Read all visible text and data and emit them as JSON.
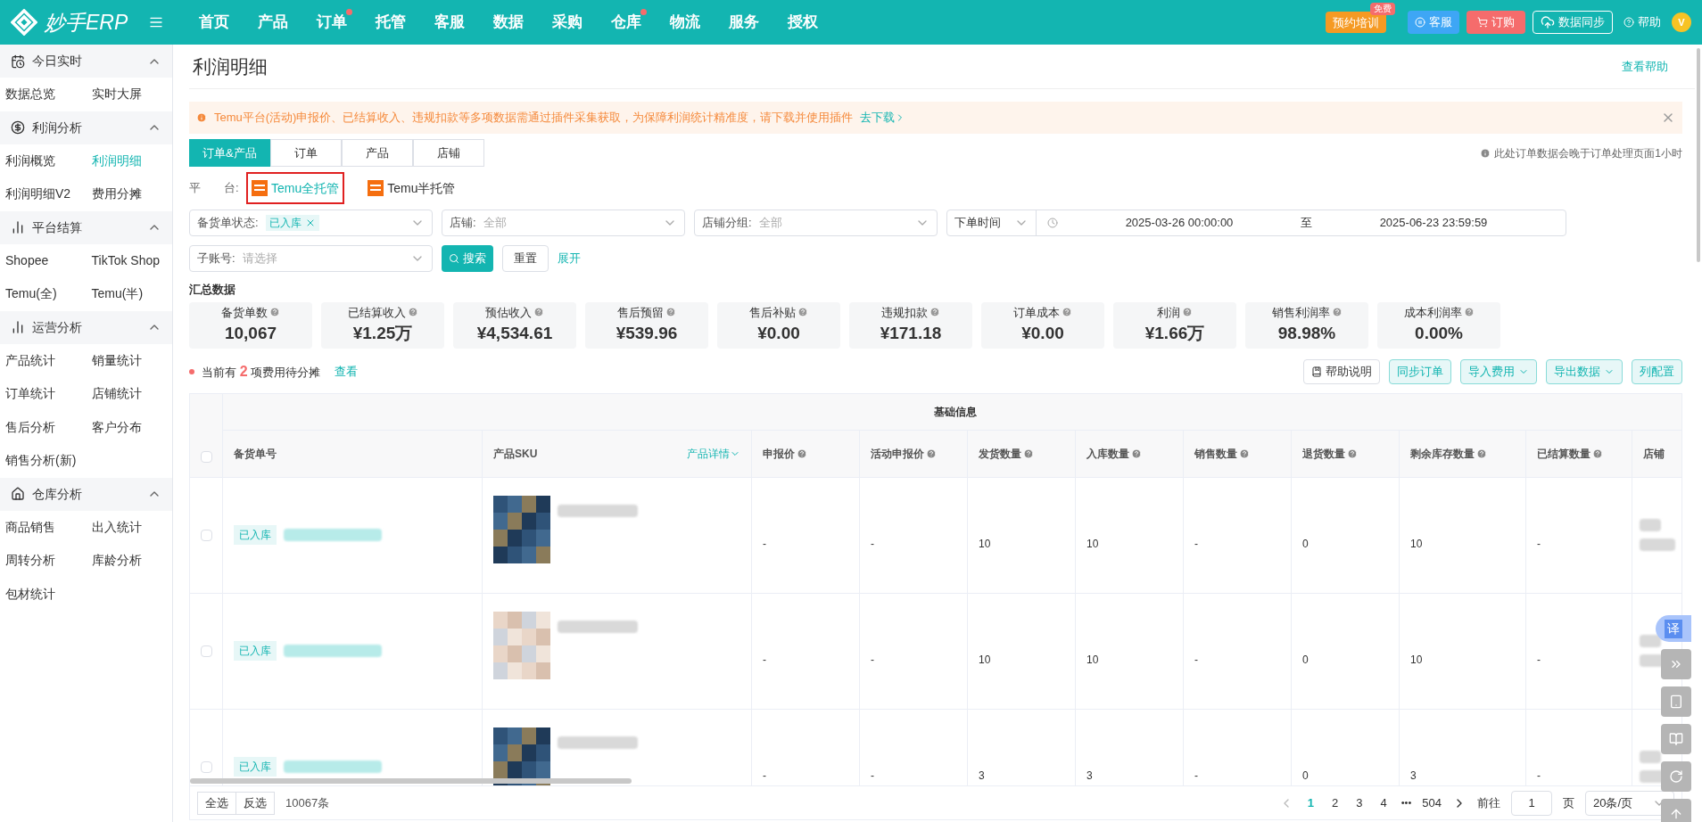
{
  "header": {
    "logo": "妙手ERP",
    "nav": [
      {
        "label": "首页",
        "dot": false
      },
      {
        "label": "产品",
        "dot": false
      },
      {
        "label": "订单",
        "dot": true
      },
      {
        "label": "托管",
        "dot": false
      },
      {
        "label": "客服",
        "dot": false
      },
      {
        "label": "数据",
        "dot": false
      },
      {
        "label": "采购",
        "dot": false
      },
      {
        "label": "仓库",
        "dot": true
      },
      {
        "label": "物流",
        "dot": false
      },
      {
        "label": "服务",
        "dot": false
      },
      {
        "label": "授权",
        "dot": false
      }
    ],
    "training": {
      "label": "预约培训",
      "badge": "免费"
    },
    "service": "客服",
    "order": "订购",
    "sync": "数据同步",
    "help": "帮助",
    "avatar": "V"
  },
  "sidebar": [
    {
      "title": "今日实时",
      "kind": "calendar",
      "expanded": true,
      "items": [
        {
          "label": "数据总览",
          "selected": false
        },
        {
          "label": "实时大屏",
          "selected": false
        }
      ]
    },
    {
      "title": "利润分析",
      "kind": "money",
      "expanded": true,
      "items": [
        {
          "label": "利润概览",
          "selected": false
        },
        {
          "label": "利润明细",
          "selected": true
        },
        {
          "label": "利润明细V2",
          "selected": false
        },
        {
          "label": "费用分摊",
          "selected": false
        }
      ]
    },
    {
      "title": "平台结算",
      "kind": "chart",
      "expanded": true,
      "items": [
        {
          "label": "Shopee",
          "selected": false
        },
        {
          "label": "TikTok Shop",
          "selected": false
        },
        {
          "label": "Temu(全)",
          "selected": false
        },
        {
          "label": "Temu(半)",
          "selected": false
        }
      ]
    },
    {
      "title": "运营分析",
      "kind": "chart",
      "expanded": true,
      "items": [
        {
          "label": "产品统计",
          "selected": false
        },
        {
          "label": "销量统计",
          "selected": false
        },
        {
          "label": "订单统计",
          "selected": false
        },
        {
          "label": "店铺统计",
          "selected": false
        },
        {
          "label": "售后分析",
          "selected": false
        },
        {
          "label": "客户分布",
          "selected": false
        },
        {
          "label": "销售分析(新)",
          "selected": false
        }
      ]
    },
    {
      "title": "仓库分析",
      "kind": "warehouse",
      "expanded": true,
      "items": [
        {
          "label": "商品销售",
          "selected": false
        },
        {
          "label": "出入统计",
          "selected": false
        },
        {
          "label": "周转分析",
          "selected": false
        },
        {
          "label": "库龄分析",
          "selected": false
        },
        {
          "label": "包材统计",
          "selected": false
        }
      ]
    }
  ],
  "page": {
    "title": "利润明细",
    "help_link": "查看帮助"
  },
  "alert": {
    "text": "Temu平台(活动)申报价、已结算收入、违规扣款等多项数据需通过插件采集获取，为保障利润统计精准度，请下载并使用插件",
    "link": "去下载"
  },
  "tabs": [
    {
      "label": "订单&产品",
      "selected": true
    },
    {
      "label": "订单",
      "selected": false
    },
    {
      "label": "产品",
      "selected": false
    },
    {
      "label": "店铺",
      "selected": false
    }
  ],
  "notice": "此处订单数据会晚于订单处理页面1小时",
  "platform": {
    "label": "平　　台:",
    "options": [
      {
        "label": "Temu全托管",
        "selected": true
      },
      {
        "label": "Temu半托管",
        "selected": false
      }
    ]
  },
  "filters": {
    "status": {
      "label": "备货单状态:",
      "tag": "已入库"
    },
    "shop": {
      "label": "店铺:",
      "placeholder": "全部"
    },
    "shop_group": {
      "label": "店铺分组:",
      "placeholder": "全部"
    },
    "time_type": "下单时间",
    "start": "2025-03-26 00:00:00",
    "sep": "至",
    "end": "2025-06-23 23:59:59",
    "sub_account": {
      "label": "子账号:",
      "placeholder": "请选择"
    },
    "search": "搜索",
    "reset": "重置",
    "expand": "展开"
  },
  "summary": {
    "title": "汇总数据",
    "cards": [
      {
        "label": "备货单数",
        "value": "10,067"
      },
      {
        "label": "已结算收入",
        "value": "¥1.25万"
      },
      {
        "label": "预估收入",
        "value": "¥4,534.61"
      },
      {
        "label": "售后预留",
        "value": "¥539.96"
      },
      {
        "label": "售后补贴",
        "value": "¥0.00"
      },
      {
        "label": "违规扣款",
        "value": "¥171.18"
      },
      {
        "label": "订单成本",
        "value": "¥0.00"
      },
      {
        "label": "利润",
        "value": "¥1.66万"
      },
      {
        "label": "销售利润率",
        "value": "98.98%"
      },
      {
        "label": "成本利润率",
        "value": "0.00%"
      }
    ]
  },
  "pending": {
    "before": "当前有",
    "count": "2",
    "after": "项费用待分摊",
    "link": "查看"
  },
  "actions": [
    {
      "label": "帮助说明",
      "kind": "help"
    },
    {
      "label": "同步订单",
      "kind": "plain"
    },
    {
      "label": "导入费用",
      "kind": "menu"
    },
    {
      "label": "导出数据",
      "kind": "menu"
    },
    {
      "label": "列配置",
      "kind": "plain"
    }
  ],
  "table": {
    "group": "基础信息",
    "all_checked": false,
    "columns": [
      {
        "label": "备货单号",
        "hint": false
      },
      {
        "label": "产品SKU",
        "hint": false,
        "link": "产品详情"
      },
      {
        "label": "申报价",
        "hint": true
      },
      {
        "label": "活动申报价",
        "hint": true
      },
      {
        "label": "发货数量",
        "hint": true
      },
      {
        "label": "入库数量",
        "hint": true
      },
      {
        "label": "销售数量",
        "hint": true
      },
      {
        "label": "退货数量",
        "hint": true
      },
      {
        "label": "剩余库存数量",
        "hint": true
      },
      {
        "label": "已结算数量",
        "hint": true
      },
      {
        "label": "店铺",
        "hint": false
      }
    ],
    "rows": [
      {
        "checked": false,
        "cells": [
          "已入库",
          "",
          "-",
          "-",
          "10",
          "10",
          "-",
          "0",
          "10",
          "-"
        ]
      },
      {
        "checked": false,
        "cells": [
          "已入库",
          "",
          "-",
          "-",
          "10",
          "10",
          "-",
          "0",
          "10",
          "-"
        ]
      },
      {
        "checked": false,
        "cells": [
          "已入库",
          "",
          "-",
          "-",
          "3",
          "3",
          "-",
          "0",
          "3",
          "-"
        ]
      }
    ]
  },
  "footer": {
    "select_all": "全选",
    "invert": "反选",
    "total": "10067条",
    "pages": [
      {
        "label": "1",
        "selected": true
      },
      {
        "label": "2",
        "selected": false
      },
      {
        "label": "3",
        "selected": false
      },
      {
        "label": "4",
        "selected": false
      }
    ],
    "ellipsis": "•••",
    "last": "504",
    "goto": "前往",
    "page_value": "1",
    "page_unit": "页",
    "page_size": "20条/页"
  },
  "float": {
    "translate": "译"
  }
}
